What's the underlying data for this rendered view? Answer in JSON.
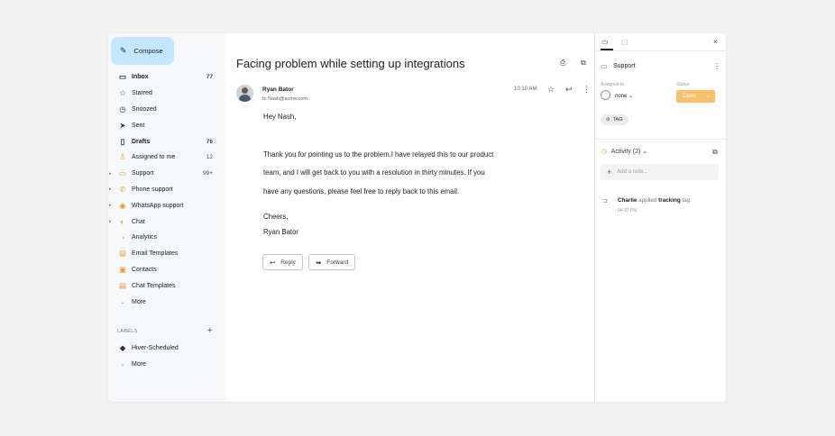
{
  "compose": {
    "label": "Compose"
  },
  "sidebar": {
    "items": [
      {
        "label": "Inbox",
        "count": "77"
      },
      {
        "label": "Starred",
        "count": ""
      },
      {
        "label": "Snoozed",
        "count": ""
      },
      {
        "label": "Sent",
        "count": ""
      },
      {
        "label": "Drafts",
        "count": "76"
      },
      {
        "label": "Assigned to me",
        "count": "12"
      },
      {
        "label": "Support",
        "count": "99+"
      },
      {
        "label": "Phone support",
        "count": ""
      },
      {
        "label": "WhatsApp support",
        "count": ""
      },
      {
        "label": "Chat",
        "count": ""
      },
      {
        "label": "Analytics",
        "count": ""
      },
      {
        "label": "Email Templates",
        "count": ""
      },
      {
        "label": "Contacts",
        "count": ""
      },
      {
        "label": "Chat Templates",
        "count": ""
      },
      {
        "label": "More",
        "count": ""
      }
    ],
    "labels_header": "LABELS",
    "labels": [
      {
        "label": "Hiver-Scheduled"
      },
      {
        "label": "More"
      }
    ]
  },
  "email": {
    "subject": "Facing problem while setting up integrations",
    "sender": "Ryan Bator",
    "to": "to Nash@acme.com",
    "time": "10:10 AM",
    "body": [
      "Hey Nash,",
      "Thank you for pointing us to the problem.I have relayed this to our product",
      "team, and I will get back to you with a resolution in thirty minutes. If you",
      "have any questions, please feel free to reply back to this email.",
      "Cheers,",
      "Ryan Bator"
    ],
    "reply_label": "Reply",
    "forward_label": "Forward"
  },
  "panel": {
    "inbox": "Support",
    "assigned_label": "Assigned to",
    "assignee": "none",
    "status_label": "Status",
    "status_value": "Open",
    "status_color": "#f7c26b",
    "tag_label": "TAG",
    "activity_label": "Activity (2)",
    "note_placeholder": "Add a note...",
    "activity_user": "Charlie",
    "activity_action": "applied",
    "activity_tag": "tracking",
    "activity_suffix": "tag",
    "activity_time": "04:37 PM"
  }
}
